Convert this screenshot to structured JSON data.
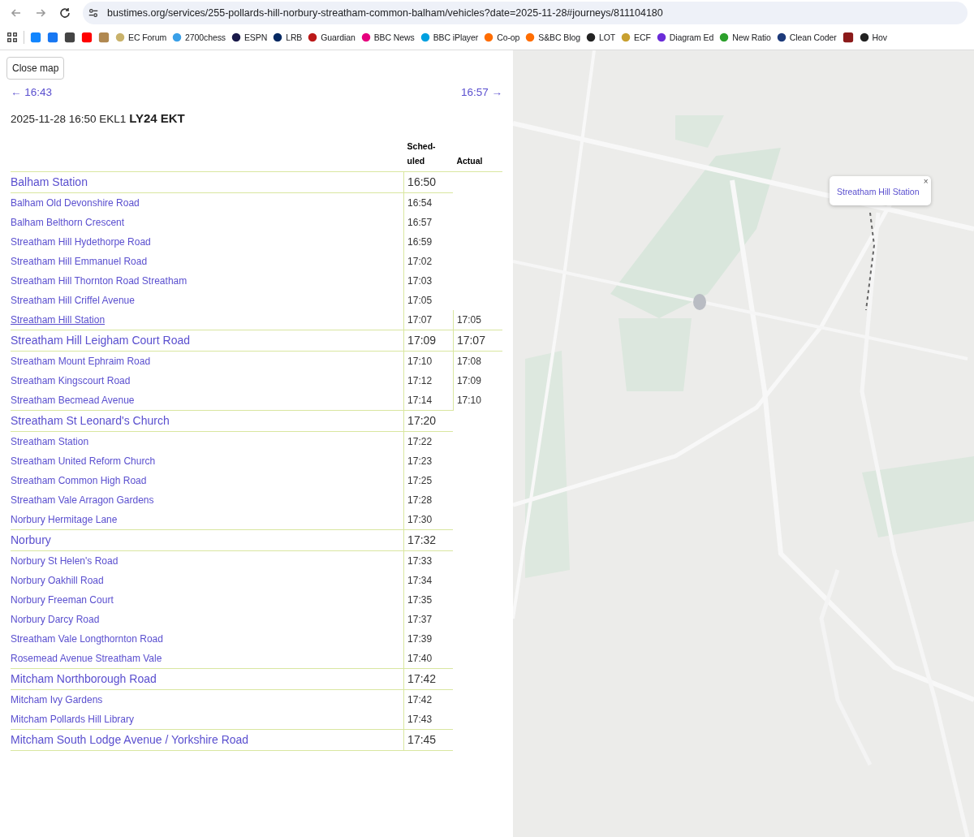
{
  "browser": {
    "url": "bustimes.org/services/255-pollards-hill-norbury-streatham-common-balham/vehicles?date=2025-11-28#journeys/811104180",
    "bookmarks": [
      {
        "kind": "apps"
      },
      {
        "kind": "icon"
      },
      {
        "kind": "icon"
      },
      {
        "kind": "icon"
      },
      {
        "kind": "icon"
      },
      {
        "kind": "icon"
      },
      {
        "kind": "labeled",
        "label": "EC Forum"
      },
      {
        "kind": "labeled",
        "label": "2700chess"
      },
      {
        "kind": "labeled",
        "label": "ESPN"
      },
      {
        "kind": "labeled",
        "label": "LRB"
      },
      {
        "kind": "labeled",
        "label": "Guardian"
      },
      {
        "kind": "labeled",
        "label": "BBC News"
      },
      {
        "kind": "labeled",
        "label": "BBC iPlayer"
      },
      {
        "kind": "labeled",
        "label": "Co-op"
      },
      {
        "kind": "labeled",
        "label": "S&BC Blog"
      },
      {
        "kind": "labeled",
        "label": "LOT"
      },
      {
        "kind": "labeled",
        "label": "ECF"
      },
      {
        "kind": "labeled",
        "label": "Diagram Ed"
      },
      {
        "kind": "labeled",
        "label": "New Ratio"
      },
      {
        "kind": "labeled",
        "label": "Clean Coder"
      },
      {
        "kind": "icon"
      },
      {
        "kind": "labeled",
        "label": "Hov"
      }
    ]
  },
  "close_button": "Close map",
  "prev_link": "← 16:43",
  "next_link": "16:57 →",
  "journey": "2025-11-28 16:50 EKL1 **LY24 EKT**",
  "table": {
    "columns": [
      "Sched-uled",
      "Actual"
    ],
    "rows": [
      {
        "stop": "Balham Station",
        "scheduled": "16:50",
        "major": true,
        "selected": false
      },
      {
        "stop": "Balham Old Devonshire Road",
        "scheduled": "16:54",
        "major": false,
        "selected": false
      },
      {
        "stop": "Balham Belthorn Crescent",
        "scheduled": "16:57",
        "major": false,
        "selected": false
      },
      {
        "stop": "Streatham Hill Hydethorpe Road",
        "scheduled": "16:59",
        "major": false,
        "selected": false
      },
      {
        "stop": "Streatham Hill Emmanuel Road",
        "scheduled": "17:02",
        "major": false,
        "selected": false
      },
      {
        "stop": "Streatham Hill Thornton Road Streatham",
        "scheduled": "17:03",
        "major": false,
        "selected": false
      },
      {
        "stop": "Streatham Hill Criffel Avenue",
        "scheduled": "17:05",
        "major": false,
        "selected": false
      },
      {
        "stop": "Streatham Hill Station",
        "scheduled": "17:07",
        "actual": "17:05",
        "major": false,
        "selected": true
      },
      {
        "stop": "Streatham Hill Leigham Court Road",
        "scheduled": "17:09",
        "actual": "17:07",
        "major": true,
        "selected": false
      },
      {
        "stop": "Streatham Mount Ephraim Road",
        "scheduled": "17:10",
        "actual": "17:08",
        "major": false,
        "selected": false
      },
      {
        "stop": "Streatham Kingscourt Road",
        "scheduled": "17:12",
        "actual": "17:09",
        "major": false,
        "selected": false
      },
      {
        "stop": "Streatham Becmead Avenue",
        "scheduled": "17:14",
        "actual": "17:10",
        "major": false,
        "selected": false
      },
      {
        "stop": "Streatham St Leonard's Church",
        "scheduled": "17:20",
        "major": true,
        "selected": false
      },
      {
        "stop": "Streatham Station",
        "scheduled": "17:22",
        "major": false,
        "selected": false
      },
      {
        "stop": "Streatham United Reform Church",
        "scheduled": "17:23",
        "major": false,
        "selected": false
      },
      {
        "stop": "Streatham Common High Road",
        "scheduled": "17:25",
        "major": false,
        "selected": false
      },
      {
        "stop": "Streatham Vale Arragon Gardens",
        "scheduled": "17:28",
        "major": false,
        "selected": false
      },
      {
        "stop": "Norbury Hermitage Lane",
        "scheduled": "17:30",
        "major": false,
        "selected": false
      },
      {
        "stop": "Norbury",
        "scheduled": "17:32",
        "major": true,
        "selected": false
      },
      {
        "stop": "Norbury St Helen's Road",
        "scheduled": "17:33",
        "major": false,
        "selected": false
      },
      {
        "stop": "Norbury Oakhill Road",
        "scheduled": "17:34",
        "major": false,
        "selected": false
      },
      {
        "stop": "Norbury Freeman Court",
        "scheduled": "17:35",
        "major": false,
        "selected": false
      },
      {
        "stop": "Norbury Darcy Road",
        "scheduled": "17:37",
        "major": false,
        "selected": false
      },
      {
        "stop": "Streatham Vale Longthornton Road",
        "scheduled": "17:39",
        "major": false,
        "selected": false
      },
      {
        "stop": "Rosemead Avenue Streatham Vale",
        "scheduled": "17:40",
        "major": false,
        "selected": false
      },
      {
        "stop": "Mitcham Northborough Road",
        "scheduled": "17:42",
        "major": true,
        "selected": false
      },
      {
        "stop": "Mitcham Ivy Gardens",
        "scheduled": "17:42",
        "major": false,
        "selected": false
      },
      {
        "stop": "Mitcham Pollards Hill Library",
        "scheduled": "17:43",
        "major": false,
        "selected": false
      },
      {
        "stop": "Mitcham South Lodge Avenue / Yorkshire Road",
        "scheduled": "17:45",
        "major": true,
        "selected": false
      }
    ]
  },
  "map": {
    "popup": {
      "title": "Streatham Hill Station",
      "close": "×"
    }
  }
}
